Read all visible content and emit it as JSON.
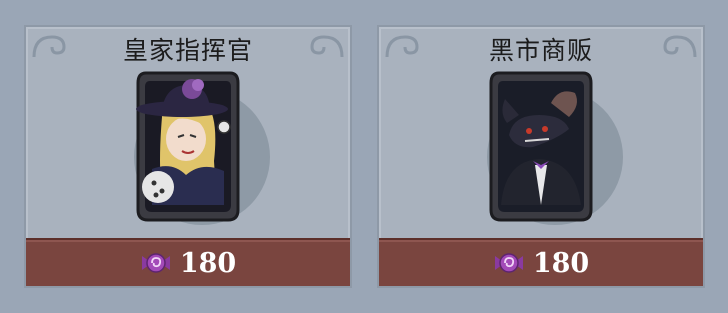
{
  "shop": {
    "cards": [
      {
        "title": "皇家指挥官",
        "price": "180",
        "portrait": "royal-commander-portrait",
        "currency_icon": "candy-icon"
      },
      {
        "title": "黑市商贩",
        "price": "180",
        "portrait": "black-market-rat-portrait",
        "currency_icon": "candy-icon"
      }
    ]
  },
  "colors": {
    "card_bg": "#a9b2be",
    "price_bar": "#7a453f",
    "price_text": "#ffffff",
    "candy": "#8a3aa0"
  }
}
